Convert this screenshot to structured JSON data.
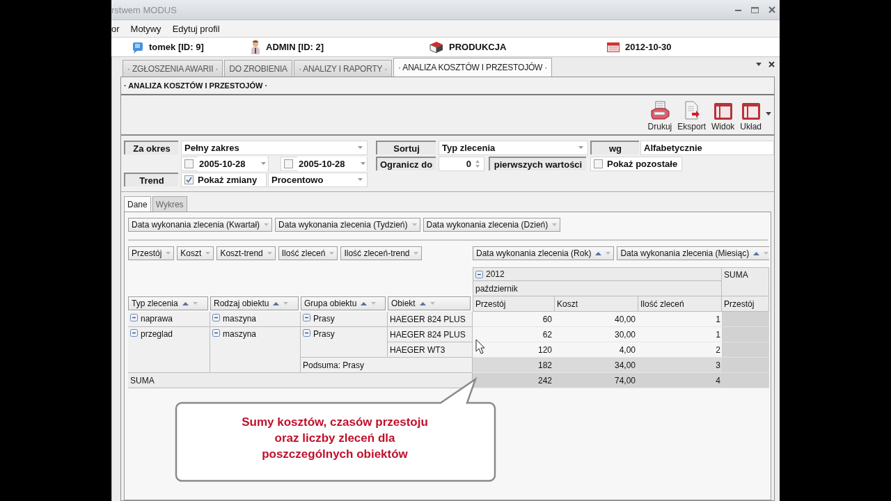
{
  "window": {
    "title": "rstwem MODUS"
  },
  "menu": [
    "or",
    "Motywy",
    "Edytuj profil"
  ],
  "info": [
    {
      "kind": "user",
      "text": "tomek [ID: 9]"
    },
    {
      "kind": "role",
      "text": "ADMIN [ID: 2]"
    },
    {
      "kind": "department",
      "text": "PRODUKCJA"
    },
    {
      "kind": "date",
      "text": "2012-10-30"
    }
  ],
  "tabs": [
    {
      "label": "· ZGŁOSZENIA AWARII ·",
      "selected": false
    },
    {
      "label": "DO ZROBIENIA",
      "selected": false
    },
    {
      "label": "· ANALIZY I RAPORTY ·",
      "selected": false
    },
    {
      "label": "· ANALIZA KOSZTÓW I PRZESTOJÓW ·",
      "selected": true
    }
  ],
  "panel_title": "· ANALIZA KOSZTÓW I PRZESTOJÓW ·",
  "toolbar": [
    {
      "kind": "print",
      "label": "Drukuj"
    },
    {
      "kind": "export",
      "label": "Eksport"
    },
    {
      "kind": "view",
      "label": "Widok"
    },
    {
      "kind": "layout",
      "label": "Układ"
    }
  ],
  "filters": {
    "period_label": "Za okres",
    "period": "Pełny zakres",
    "date_from": {
      "checked": false,
      "value": "2005-10-28"
    },
    "date_to": {
      "checked": false,
      "value": "2005-10-28"
    },
    "trend_label": "Trend",
    "show_changes": {
      "checked": true,
      "label": "Pokaż zmiany"
    },
    "trend_mode": "Procentowo",
    "sort_label": "Sortuj",
    "sort_by": "Typ zlecenia",
    "order_label": "wg",
    "order": "Alfabetycznie",
    "limit_label": "Ogranicz do",
    "limit": "0",
    "limit_suffix": "pierwszych wartości",
    "show_rest": {
      "checked": false,
      "label": "Pokaż pozostałe"
    }
  },
  "view_tabs": [
    {
      "label": "Dane",
      "selected": true
    },
    {
      "label": "Wykres",
      "selected": false
    }
  ],
  "pivot": {
    "filter_fields": [
      {
        "label": "Data wykonania zlecenia (Kwartał)"
      },
      {
        "label": "Data wykonania zlecenia (Tydzień)"
      },
      {
        "label": "Data wykonania zlecenia (Dzień)"
      }
    ],
    "data_fields": [
      {
        "label": "Przestój"
      },
      {
        "label": "Koszt"
      },
      {
        "label": "Koszt-trend"
      },
      {
        "label": "Ilość zleceń"
      },
      {
        "label": "Ilość zleceń-trend"
      }
    ],
    "column_fields": [
      {
        "label": "Data wykonania zlecenia (Rok)",
        "sorted": true
      },
      {
        "label": "Data wykonania zlecenia (Miesiąc)",
        "sorted": true
      }
    ],
    "row_fields": [
      {
        "label": "Typ zlecenia",
        "sorted": true
      },
      {
        "label": "Rodzaj obiektu",
        "sorted": true
      },
      {
        "label": "Grupa obiektu",
        "sorted": true
      },
      {
        "label": "Obiekt",
        "sorted": true
      }
    ],
    "year": {
      "text": "2012",
      "expanded": true
    },
    "month": "październik",
    "grand_total": "SUMA",
    "value_headers": [
      "Przestój",
      "Koszt",
      "Ilość zleceń",
      "Przestój"
    ],
    "rows": [
      {
        "kind": "item",
        "typ": {
          "text": "naprawa",
          "expanded": true
        },
        "rodzaj": {
          "text": "maszyna",
          "expanded": true
        },
        "grupa": {
          "text": "Prasy",
          "expanded": true
        },
        "obiekt": "HAEGER 824 PLUS",
        "values": [
          "60",
          "40,00",
          "1"
        ]
      },
      {
        "kind": "item",
        "typ": {
          "text": "przeglad",
          "expanded": true
        },
        "rodzaj": {
          "text": "maszyna",
          "expanded": true
        },
        "grupa": {
          "text": "Prasy",
          "expanded": true
        },
        "obiekt": "HAEGER 824 PLUS",
        "values": [
          "62",
          "30,00",
          "1"
        ]
      },
      {
        "kind": "item",
        "obiekt": "HAEGER WT3",
        "values": [
          "120",
          "4,00",
          "2"
        ]
      },
      {
        "kind": "subtotal",
        "label": "Podsuma: Prasy",
        "values": [
          "182",
          "34,00",
          "3"
        ]
      },
      {
        "kind": "total",
        "label": "SUMA",
        "values": [
          "242",
          "74,00",
          "4"
        ]
      }
    ]
  },
  "callout": {
    "lines": [
      "Sumy kosztów, czasów przestoju",
      "oraz liczby zleceń dla",
      "poszczególnych obiektów"
    ]
  }
}
